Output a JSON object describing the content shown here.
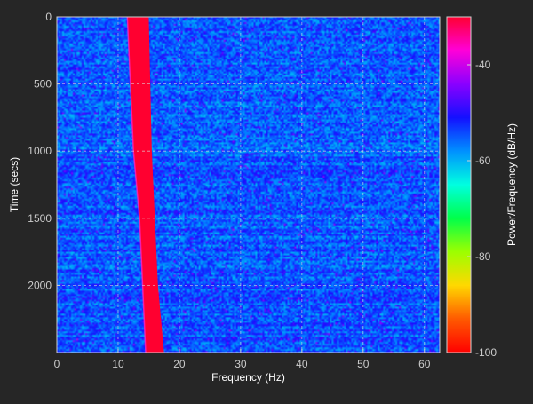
{
  "chart_data": {
    "type": "heatmap",
    "title": "",
    "xlabel": "Frequency (Hz)",
    "ylabel": "Time (secs)",
    "xlim": [
      0,
      62.5
    ],
    "ylim": [
      0,
      2500
    ],
    "y_direction": "downward",
    "xticks": [
      0,
      10,
      20,
      30,
      40,
      50,
      60
    ],
    "xtick_labels": [
      "0",
      "10",
      "20",
      "30",
      "40",
      "50",
      "60"
    ],
    "yticks": [
      0,
      500,
      1000,
      1500,
      2000
    ],
    "ytick_labels": [
      "0",
      "500",
      "1000",
      "1500",
      "2000"
    ],
    "grid": true,
    "colorbar": {
      "label": "Power/Frequency (dB/Hz)",
      "range": [
        -100,
        -30
      ],
      "ticks": [
        -40,
        -60,
        -80,
        -100
      ],
      "tick_labels": [
        "-40",
        "-60",
        "-80",
        "-100"
      ],
      "colormap": "hsv-reversed"
    },
    "background_level_db": -55,
    "dominant_band": {
      "description": "high-power band drifting upward in frequency over time",
      "level_db": -30,
      "points": [
        {
          "time": 0,
          "freq_start": 11.5,
          "freq_end": 15.0
        },
        {
          "time": 1000,
          "freq_start": 12.5,
          "freq_end": 15.5
        },
        {
          "time": 1500,
          "freq_start": 13.5,
          "freq_end": 16.0
        },
        {
          "time": 2000,
          "freq_start": 14.0,
          "freq_end": 16.5
        },
        {
          "time": 2500,
          "freq_start": 14.5,
          "freq_end": 17.5
        }
      ]
    }
  }
}
